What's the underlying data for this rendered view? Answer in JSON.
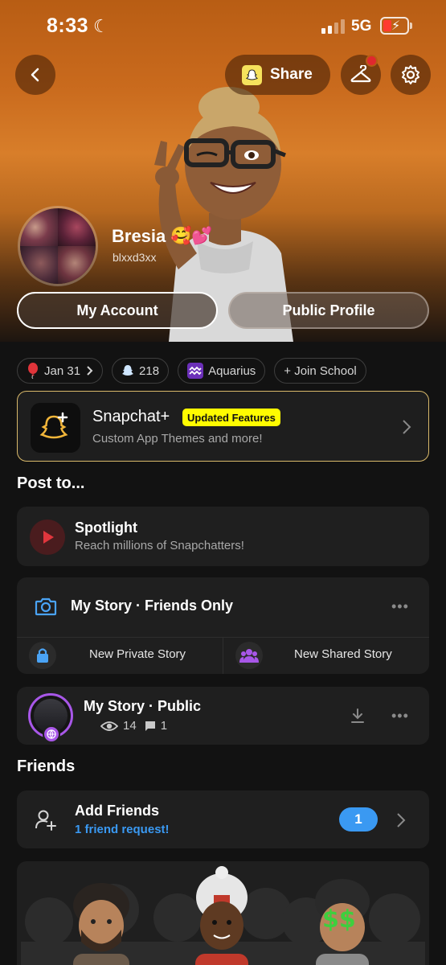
{
  "status_bar": {
    "time": "8:33",
    "network": "5G"
  },
  "header": {
    "share_label": "Share"
  },
  "profile": {
    "display_name": "Bresia",
    "name_emoji": "🥰💕",
    "username": "blxxd3xx",
    "my_account_label": "My Account",
    "public_profile_label": "Public Profile"
  },
  "chips": {
    "birthday": "Jan 31",
    "snapscore": "218",
    "zodiac": "Aquarius",
    "school": "+ Join School"
  },
  "snapchat_plus": {
    "title": "Snapchat+",
    "badge": "Updated Features",
    "subtitle": "Custom App Themes and more!"
  },
  "post_to": {
    "heading": "Post to...",
    "spotlight": {
      "title": "Spotlight",
      "subtitle": "Reach millions of Snapchatters!"
    },
    "my_story_friends": {
      "title": "My Story · Friends Only",
      "more": "•••"
    },
    "new_private_story": "New Private Story",
    "new_shared_story": "New Shared Story",
    "my_story_public": {
      "title": "My Story · Public",
      "views": "14",
      "replies": "1",
      "more": "•••"
    }
  },
  "friends": {
    "heading": "Friends",
    "add_friends_title": "Add Friends",
    "friend_request_text": "1 friend request!",
    "request_count": "1"
  },
  "colors": {
    "accent_blue": "#3a99f2",
    "snap_yellow": "#fffc00",
    "story_purple": "#a857e8",
    "spotlight_red": "#e0363d",
    "gold_border": "#d9b96a"
  }
}
